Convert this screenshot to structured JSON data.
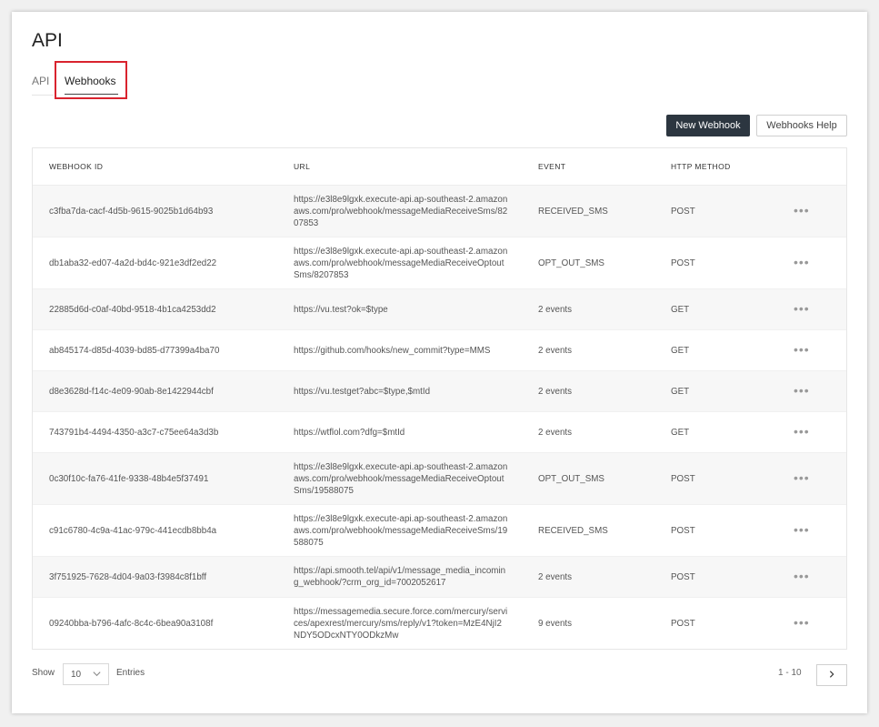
{
  "page": {
    "title": "API"
  },
  "tabs": [
    {
      "label": "API",
      "active": false
    },
    {
      "label": "Webhooks",
      "active": true
    }
  ],
  "toolbar": {
    "new_webhook_label": "New Webhook",
    "help_label": "Webhooks Help"
  },
  "table": {
    "columns": [
      "WEBHOOK ID",
      "URL",
      "EVENT",
      "HTTP METHOD"
    ],
    "rows": [
      {
        "id": "c3fba7da-cacf-4d5b-9615-9025b1d64b93",
        "url": "https://e3l8e9lgxk.execute-api.ap-southeast-2.amazonaws.com/pro/webhook/messageMediaReceiveSms/8207853",
        "event": "RECEIVED_SMS",
        "method": "POST"
      },
      {
        "id": "db1aba32-ed07-4a2d-bd4c-921e3df2ed22",
        "url": "https://e3l8e9lgxk.execute-api.ap-southeast-2.amazonaws.com/pro/webhook/messageMediaReceiveOptoutSms/8207853",
        "event": "OPT_OUT_SMS",
        "method": "POST"
      },
      {
        "id": "22885d6d-c0af-40bd-9518-4b1ca4253dd2",
        "url": "https://vu.test?ok=$type",
        "event": "2 events",
        "method": "GET"
      },
      {
        "id": "ab845174-d85d-4039-bd85-d77399a4ba70",
        "url": "https://github.com/hooks/new_commit?type=MMS",
        "event": "2 events",
        "method": "GET"
      },
      {
        "id": "d8e3628d-f14c-4e09-90ab-8e1422944cbf",
        "url": "https://vu.testget?abc=$type,$mtId",
        "event": "2 events",
        "method": "GET"
      },
      {
        "id": "743791b4-4494-4350-a3c7-c75ee64a3d3b",
        "url": "https://wtflol.com?dfg=$mtId",
        "event": "2 events",
        "method": "GET"
      },
      {
        "id": "0c30f10c-fa76-41fe-9338-48b4e5f37491",
        "url": "https://e3l8e9lgxk.execute-api.ap-southeast-2.amazonaws.com/pro/webhook/messageMediaReceiveOptoutSms/19588075",
        "event": "OPT_OUT_SMS",
        "method": "POST"
      },
      {
        "id": "c91c6780-4c9a-41ac-979c-441ecdb8bb4a",
        "url": "https://e3l8e9lgxk.execute-api.ap-southeast-2.amazonaws.com/pro/webhook/messageMediaReceiveSms/19588075",
        "event": "RECEIVED_SMS",
        "method": "POST"
      },
      {
        "id": "3f751925-7628-4d04-9a03-f3984c8f1bff",
        "url": "https://api.smooth.tel/api/v1/message_media_incoming_webhook/?crm_org_id=7002052617",
        "event": "2 events",
        "method": "POST"
      },
      {
        "id": "09240bba-b796-4afc-8c4c-6bea90a3108f",
        "url": "https://messagemedia.secure.force.com/mercury/services/apexrest/mercury/sms/reply/v1?token=MzE4NjI2NDY5ODcxNTY0ODkzMw",
        "event": "9 events",
        "method": "POST"
      }
    ],
    "row_action_label": "•••"
  },
  "footer": {
    "show_label": "Show",
    "page_size": "10",
    "entries_label": "Entries",
    "range_label": "1 - 10"
  },
  "icons": {
    "chevron_down": "chevron-down-icon",
    "chevron_right": "chevron-right-icon"
  }
}
